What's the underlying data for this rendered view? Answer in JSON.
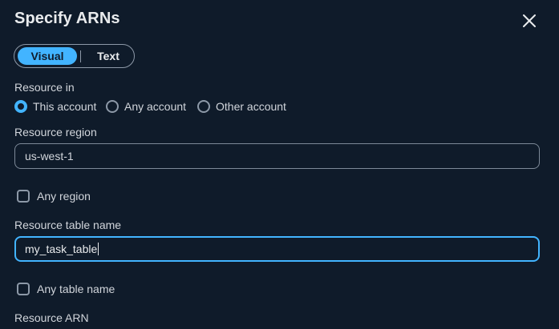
{
  "dialog": {
    "title": "Specify ARNs",
    "close_icon": "close-icon"
  },
  "mode_toggle": {
    "options": [
      "Visual",
      "Text"
    ],
    "selected": "Visual",
    "accent_color": "#42b4ff"
  },
  "resource_in": {
    "label": "Resource in",
    "options": [
      {
        "label": "This account",
        "selected": true
      },
      {
        "label": "Any account",
        "selected": false
      },
      {
        "label": "Other account",
        "selected": false
      }
    ]
  },
  "resource_region": {
    "label": "Resource region",
    "value": "us-west-1"
  },
  "any_region": {
    "label": "Any region",
    "checked": false
  },
  "resource_table_name": {
    "label": "Resource table name",
    "value": "my_task_table"
  },
  "any_table_name": {
    "label": "Any table name",
    "checked": false
  },
  "resource_arn": {
    "label": "Resource ARN"
  }
}
